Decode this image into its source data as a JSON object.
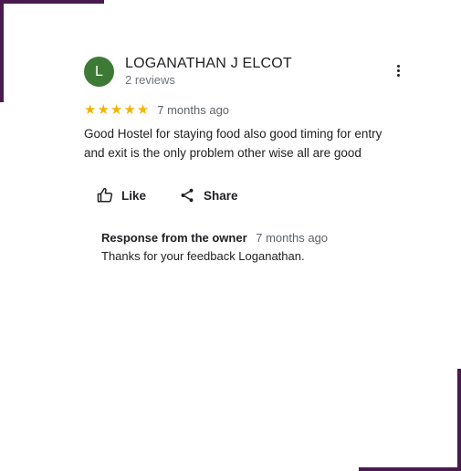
{
  "reviewer": {
    "avatar_letter": "L",
    "name": "LOGANATHAN J ELCOT",
    "review_count": "2 reviews"
  },
  "review": {
    "stars": "★★★★★",
    "rating": 5,
    "time": "7 months ago",
    "text": "Good Hostel for staying food also good timing for entry and exit is the only problem other wise all are good"
  },
  "actions": {
    "like_label": "Like",
    "share_label": "Share"
  },
  "owner_response": {
    "title": "Response from the owner",
    "time": "7 months ago",
    "text": "Thanks for your feedback Loganathan."
  },
  "colors": {
    "frame": "#4a1a4f",
    "avatar": "#3d7a35",
    "star": "#f4b400"
  }
}
